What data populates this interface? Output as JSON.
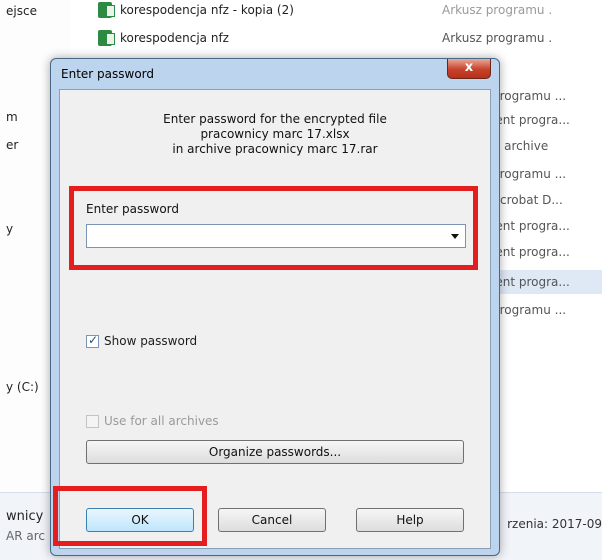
{
  "background": {
    "files": [
      {
        "name": "korespodencja nfz - kopia (2)",
        "type": "Arkusz programu ..."
      },
      {
        "name": "korespodencja nfz",
        "type": "Arkusz programu ..."
      }
    ],
    "left_labels": [
      "ejsce",
      "m",
      "er",
      "y",
      "y (C:)"
    ],
    "type_column": [
      "programu ...",
      "ient progra...",
      "R archive",
      "programu ...",
      "Acrobat D...",
      "ient progra...",
      "ient progra...",
      "ient progra...",
      "programu ..."
    ],
    "bottom": {
      "line1": "wnicy",
      "line2": "AR arc",
      "date": "rzenia: 2017-09"
    }
  },
  "dialog": {
    "title": "Enter password",
    "close_label": "x",
    "info_lines": [
      "Enter password for the encrypted file",
      "pracownicy marc 17.xlsx",
      "in archive pracownicy marc 17.rar"
    ],
    "password_label": "Enter password",
    "password_value": "",
    "show_password_label": "Show password",
    "show_password_checked": true,
    "use_all_label": "Use for all archives",
    "organize_label": "Organize passwords...",
    "ok_label": "OK",
    "cancel_label": "Cancel",
    "help_label": "Help"
  },
  "colors": {
    "highlight": "#e41e1e",
    "frame": "#bdd4ee",
    "client": "#f0f0f0",
    "close": "#c7422a"
  }
}
